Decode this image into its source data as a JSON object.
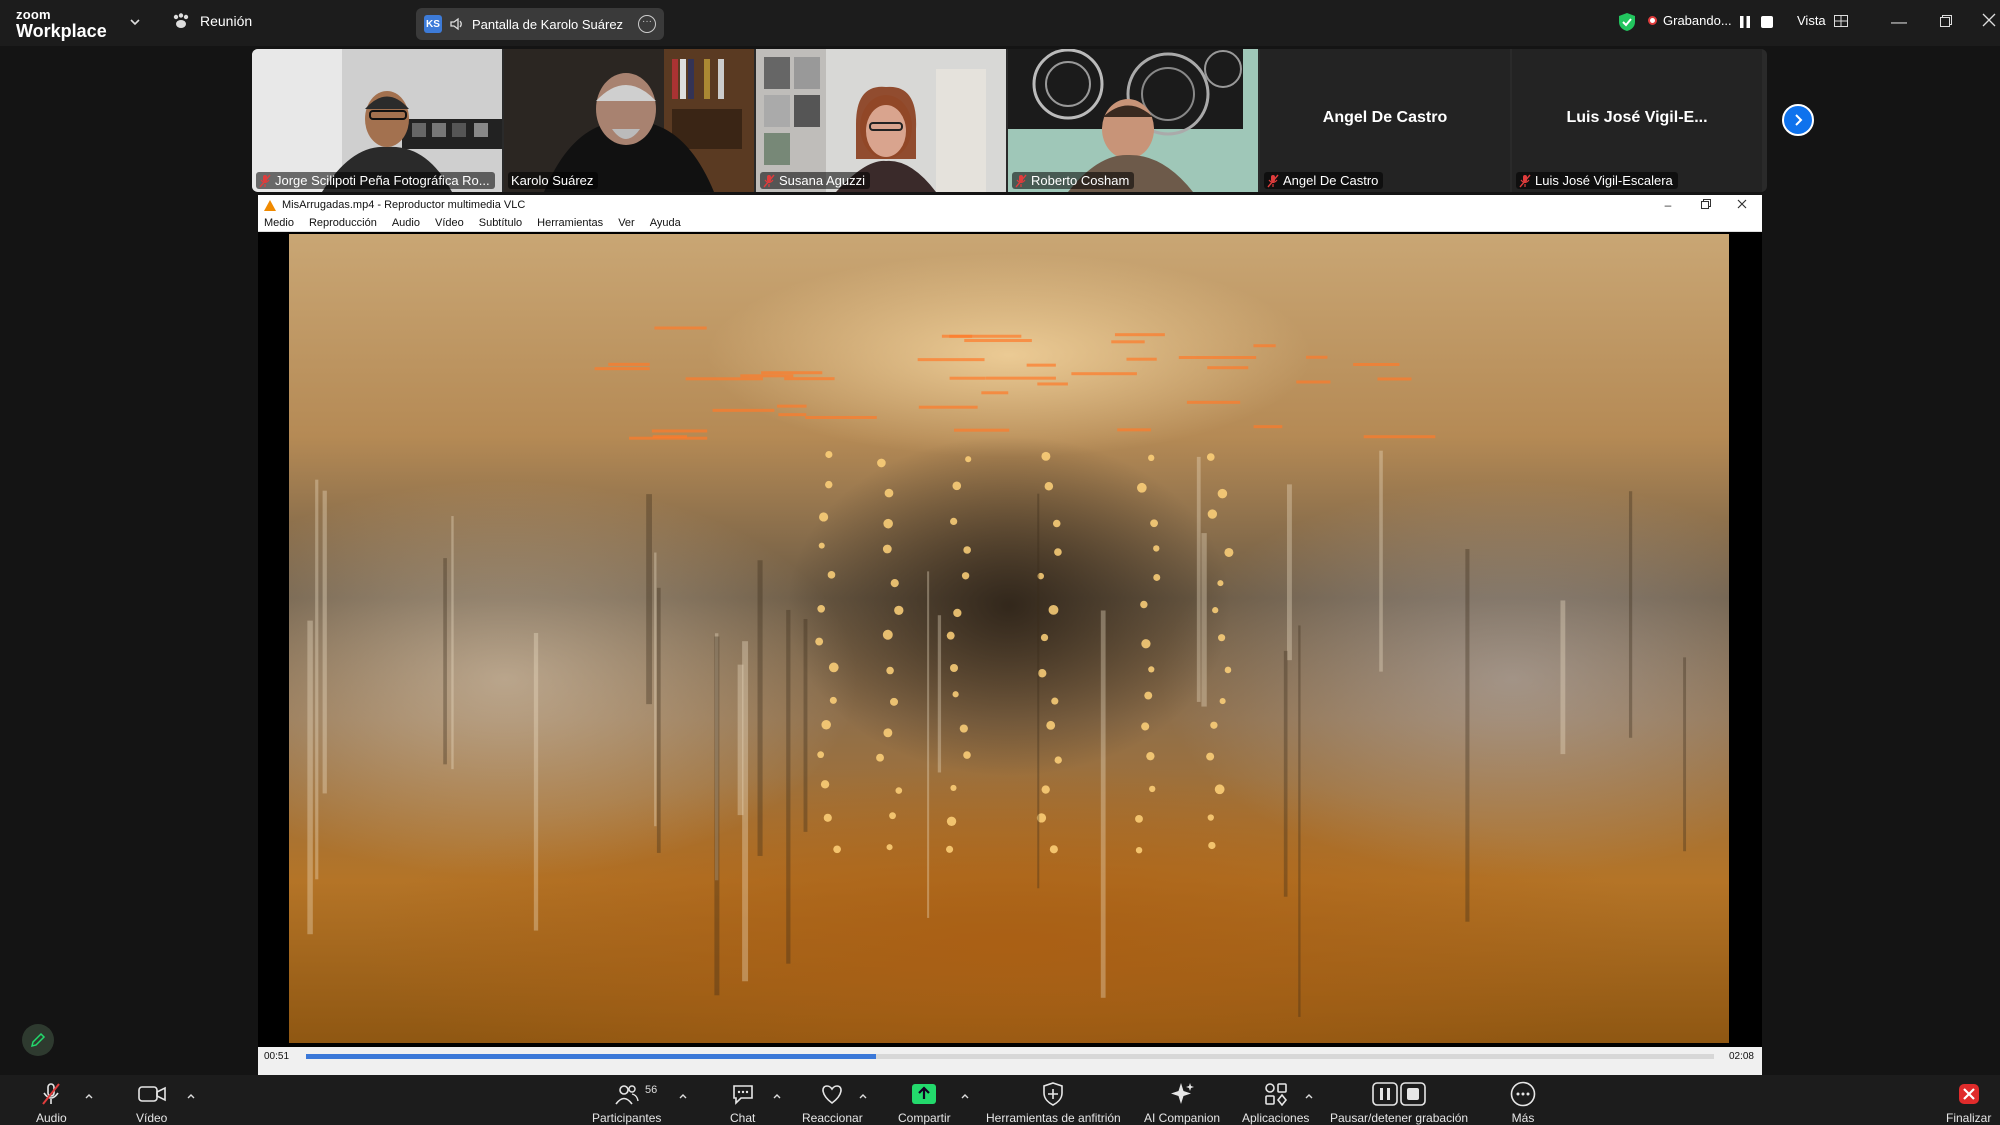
{
  "topbar": {
    "brand_top": "zoom",
    "brand_bottom": "Workplace",
    "meeting_label": "Reunión",
    "share_initials": "KS",
    "share_label": "Pantalla de Karolo Suárez",
    "recording_label": "Grabando...",
    "view_label": "Vista"
  },
  "participants": [
    {
      "name": "Jorge Scilipoti Peña Fotográfica Ro...",
      "muted": true,
      "video": true
    },
    {
      "name": "Karolo Suárez",
      "muted": false,
      "video": true,
      "active": true
    },
    {
      "name": "Susana Aguzzi",
      "muted": true,
      "video": true
    },
    {
      "name": "Roberto Cosham",
      "muted": true,
      "video": true
    },
    {
      "name": "Angel De Castro",
      "muted": true,
      "video": false,
      "big_name": "Angel De Castro"
    },
    {
      "name": "Luis José Vigil-Escalera",
      "muted": true,
      "video": false,
      "big_name": "Luis José Vigil-E..."
    }
  ],
  "vlc": {
    "title": "MisArrugadas.mp4 - Reproductor multimedia VLC",
    "menu": [
      "Medio",
      "Reproducción",
      "Audio",
      "Vídeo",
      "Subtítulo",
      "Herramientas",
      "Ver",
      "Ayuda"
    ],
    "time_elapsed": "00:51",
    "time_total": "02:08",
    "progress": 0.405
  },
  "toolbar": {
    "items": [
      {
        "label": "Audio",
        "icon": "mic-muted-icon"
      },
      {
        "label": "Vídeo",
        "icon": "video-camera-icon"
      },
      {
        "label": "Participantes",
        "icon": "participants-icon"
      },
      {
        "label": "Chat",
        "icon": "chat-icon"
      },
      {
        "label": "Reaccionar",
        "icon": "heart-icon"
      },
      {
        "label": "Compartir",
        "icon": "share-screen-icon"
      },
      {
        "label": "Herramientas de anfitrión",
        "icon": "shield-icon"
      },
      {
        "label": "AI Companion",
        "icon": "sparkle-icon"
      },
      {
        "label": "Aplicaciones",
        "icon": "apps-icon"
      },
      {
        "label": "Pausar/detener grabación",
        "icon": "recording-controls-icon"
      },
      {
        "label": "Más",
        "icon": "more-icon"
      },
      {
        "label": "Finalizar",
        "icon": "end-meeting-icon"
      }
    ],
    "participants_count": "56"
  },
  "colors": {
    "accent_blue": "#0e72ed",
    "active_speaker": "#22c55e",
    "muted_red": "#e03c3c",
    "share_green": "#23d96c"
  }
}
